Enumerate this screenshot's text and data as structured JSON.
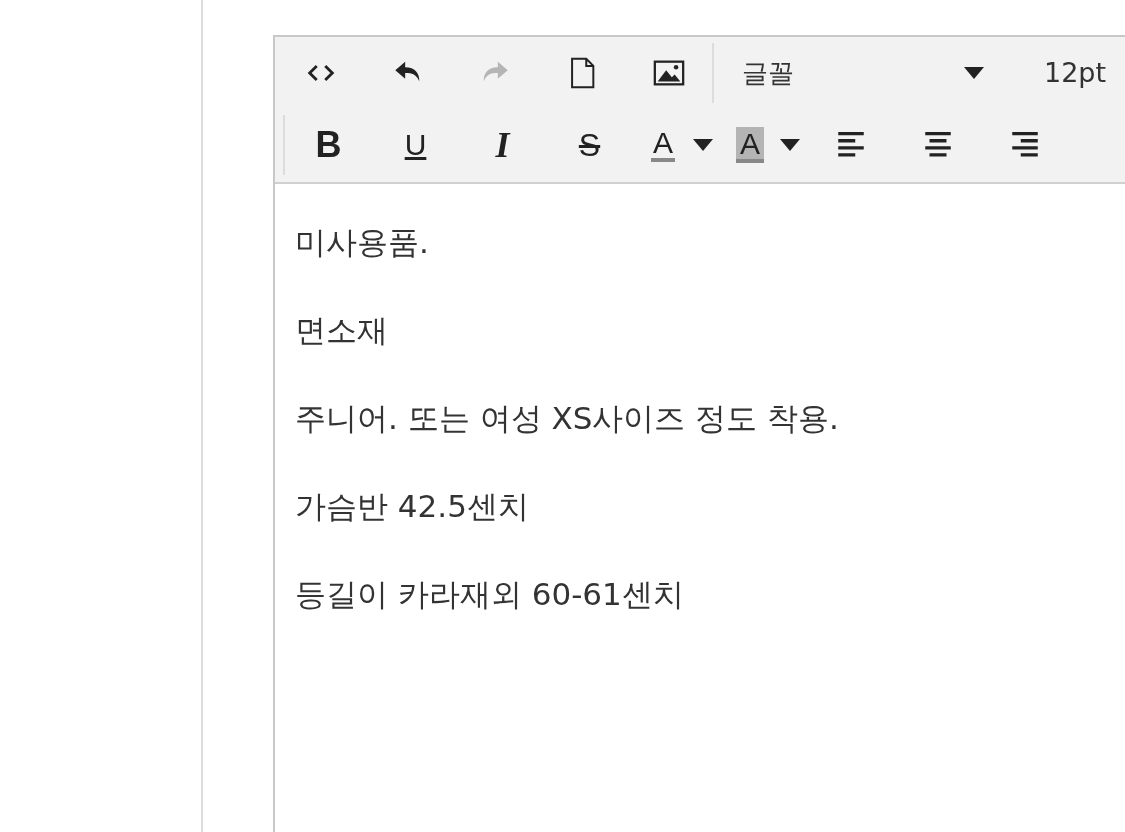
{
  "toolbar": {
    "row_1": [
      {
        "kind": "code",
        "disabled": false
      },
      {
        "kind": "undo",
        "disabled": false
      },
      {
        "kind": "redo",
        "disabled": true
      },
      {
        "kind": "new-document",
        "disabled": false
      },
      {
        "kind": "image",
        "disabled": false
      }
    ],
    "font_select": {
      "label": "글꼴"
    },
    "font_size": "12pt",
    "row_2": [
      {
        "kind": "bold",
        "label": "B"
      },
      {
        "kind": "underline",
        "label": "U"
      },
      {
        "kind": "italic",
        "label": "I"
      },
      {
        "kind": "strikethrough",
        "label": "S"
      },
      {
        "kind": "text-color",
        "label": "A"
      },
      {
        "kind": "background-color",
        "label": "A"
      },
      {
        "kind": "align-left"
      },
      {
        "kind": "align-center"
      },
      {
        "kind": "align-right"
      }
    ]
  },
  "content": {
    "paragraphs": [
      "미사용품.",
      "면소재",
      "주니어. 또는 여성 XS사이즈 정도 착용.",
      "가슴반 42.5센치",
      "등길이 카라재외 60-61센치"
    ]
  }
}
